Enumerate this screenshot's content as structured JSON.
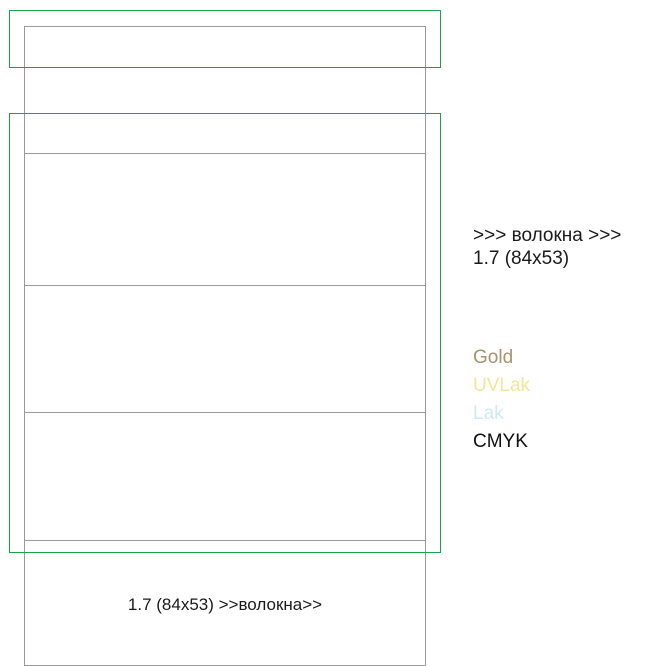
{
  "page": {
    "footer_text": "1.7 (84x53) >>волокна>>",
    "side_text": {
      "line1": ">>> волокна >>>",
      "line2": "1.7 (84x53)"
    }
  },
  "legend": [
    {
      "label": "Gold",
      "color": "#a89370"
    },
    {
      "label": "UVLak",
      "color": "#f3e59a"
    },
    {
      "label": "Lak",
      "color": "#cfe9f4"
    },
    {
      "label": "CMYK",
      "color": "#111111"
    }
  ],
  "colors": {
    "guide": "#1aa34a",
    "outline": "#9a9a9a"
  }
}
